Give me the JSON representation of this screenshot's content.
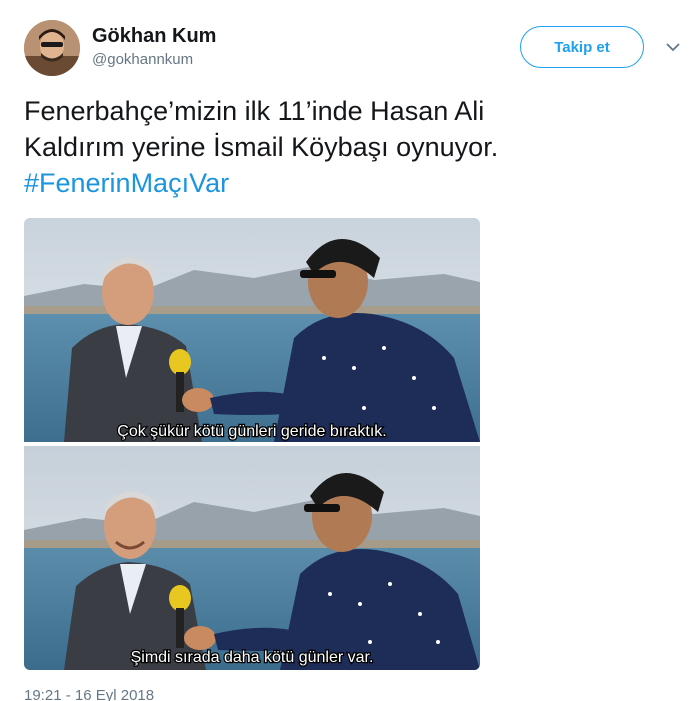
{
  "author": {
    "display_name": "Gökhan Kum",
    "handle": "@gokhannkum",
    "avatar_icon": "user-avatar"
  },
  "follow_button": {
    "label": "Takip et"
  },
  "menu_icon": "chevron-down-icon",
  "tweet": {
    "text_line1": "Fenerbahçe’mizin ilk 11’inde Hasan Ali",
    "text_line2": "Kaldırım yerine İsmail Köybaşı oynuyor.",
    "hashtag": "#FenerinMaçıVar"
  },
  "media": {
    "frame1_subtitle": "Çok şükür kötü günleri geride bıraktık.",
    "frame2_subtitle": "Şimdi sırada daha kötü günler var."
  },
  "timestamp": "19:21 - 16 Eyl 2018",
  "colors": {
    "accent": "#1da1f2",
    "hashtag": "#1b95e0",
    "muted": "#657786"
  }
}
